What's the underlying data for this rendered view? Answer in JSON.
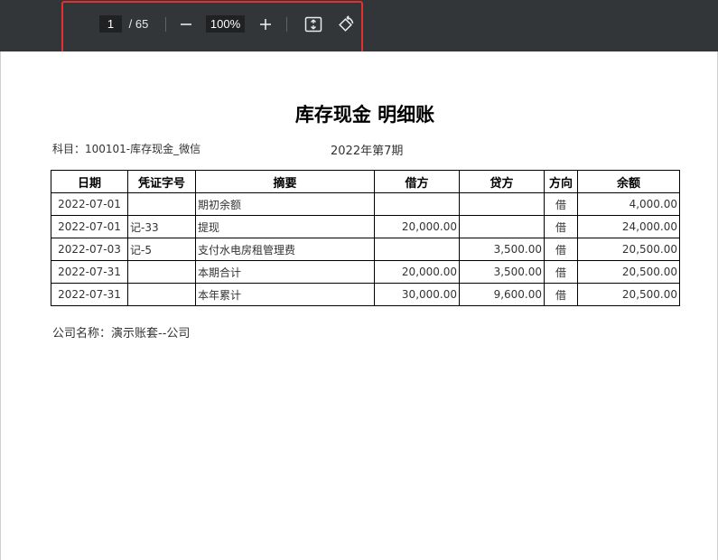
{
  "toolbar": {
    "current_page": "1",
    "page_total": " / 65",
    "zoom": "100%",
    "icons": [
      "minus-icon",
      "plus-icon",
      "fit-page-icon",
      "rotate-icon"
    ]
  },
  "document": {
    "title": "库存现金 明细账",
    "subject": "科目：100101-库存现金_微信",
    "period": "2022年第7期",
    "columns": [
      "日期",
      "凭证字号",
      "摘要",
      "借方",
      "贷方",
      "方向",
      "余额"
    ],
    "rows": [
      {
        "date": "2022-07-01",
        "voucher": "",
        "summary": "期初余额",
        "debit": "",
        "credit": "",
        "direction": "借",
        "balance": "4,000.00"
      },
      {
        "date": "2022-07-01",
        "voucher": "记-33",
        "summary": "提现",
        "debit": "20,000.00",
        "credit": "",
        "direction": "借",
        "balance": "24,000.00"
      },
      {
        "date": "2022-07-03",
        "voucher": "记-5",
        "summary": "支付水电房租管理费",
        "debit": "",
        "credit": "3,500.00",
        "direction": "借",
        "balance": "20,500.00"
      },
      {
        "date": "2022-07-31",
        "voucher": "",
        "summary": "本期合计",
        "debit": "20,000.00",
        "credit": "3,500.00",
        "direction": "借",
        "balance": "20,500.00"
      },
      {
        "date": "2022-07-31",
        "voucher": "",
        "summary": "本年累计",
        "debit": "30,000.00",
        "credit": "9,600.00",
        "direction": "借",
        "balance": "20,500.00"
      }
    ],
    "company": "公司名称：演示账套--公司"
  },
  "colors": {
    "toolbar_bg": "#323639",
    "highlight": "#e4312f"
  }
}
